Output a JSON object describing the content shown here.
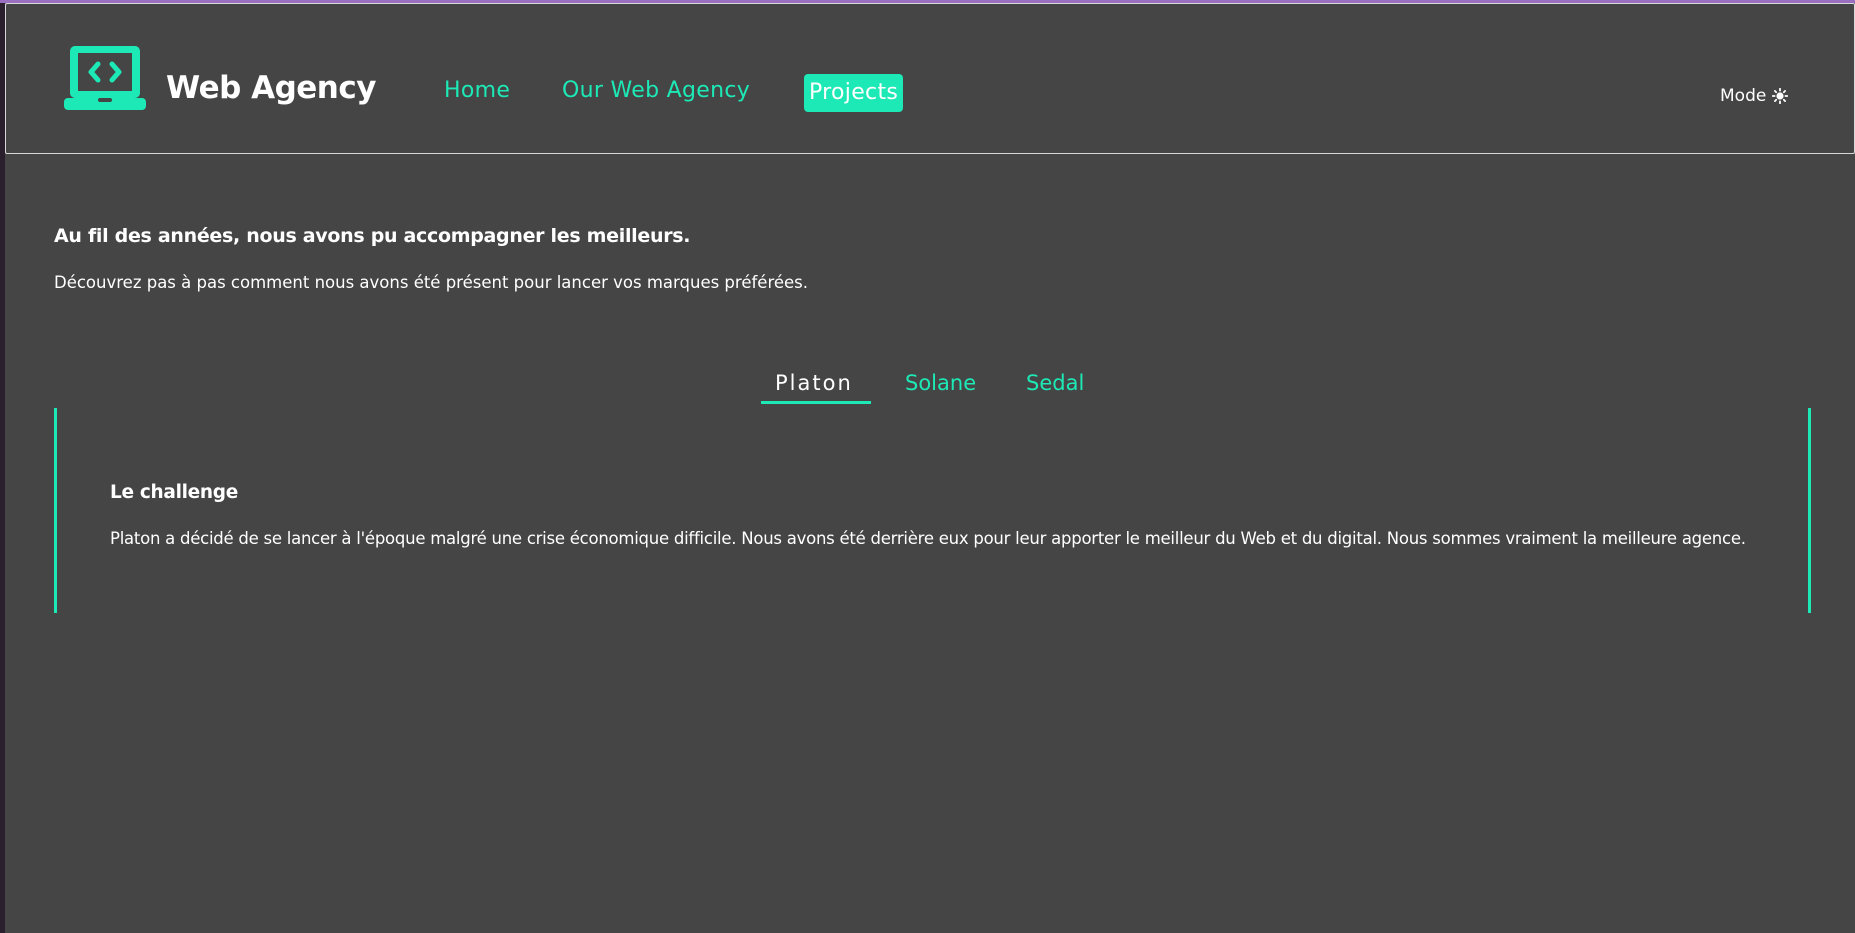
{
  "header": {
    "brand": "Web Agency",
    "nav": [
      {
        "label": "Home"
      },
      {
        "label": "Our Web Agency"
      },
      {
        "label": "Projects",
        "active": true
      }
    ],
    "mode_label": "Mode",
    "icons": {
      "logo": "laptop-code-icon",
      "mode": "sun-icon"
    }
  },
  "intro": {
    "headline": "Au fil des années, nous avons pu accompagner les meilleurs.",
    "subline": "Découvrez pas à pas comment nous avons été présent pour lancer vos marques préférées."
  },
  "tabs": [
    {
      "label": "Platon",
      "active": true
    },
    {
      "label": "Solane"
    },
    {
      "label": "Sedal"
    }
  ],
  "panel": {
    "title": "Le challenge",
    "body": "Platon a décidé de se lancer à l'époque malgré une crise économique difficile. Nous avons été derrière eux pour leur apporter le meilleur du Web et du digital. Nous sommes vraiment la meilleure agence."
  },
  "colors": {
    "accent": "#1de9b6",
    "background": "#454545",
    "text": "#ffffff"
  }
}
